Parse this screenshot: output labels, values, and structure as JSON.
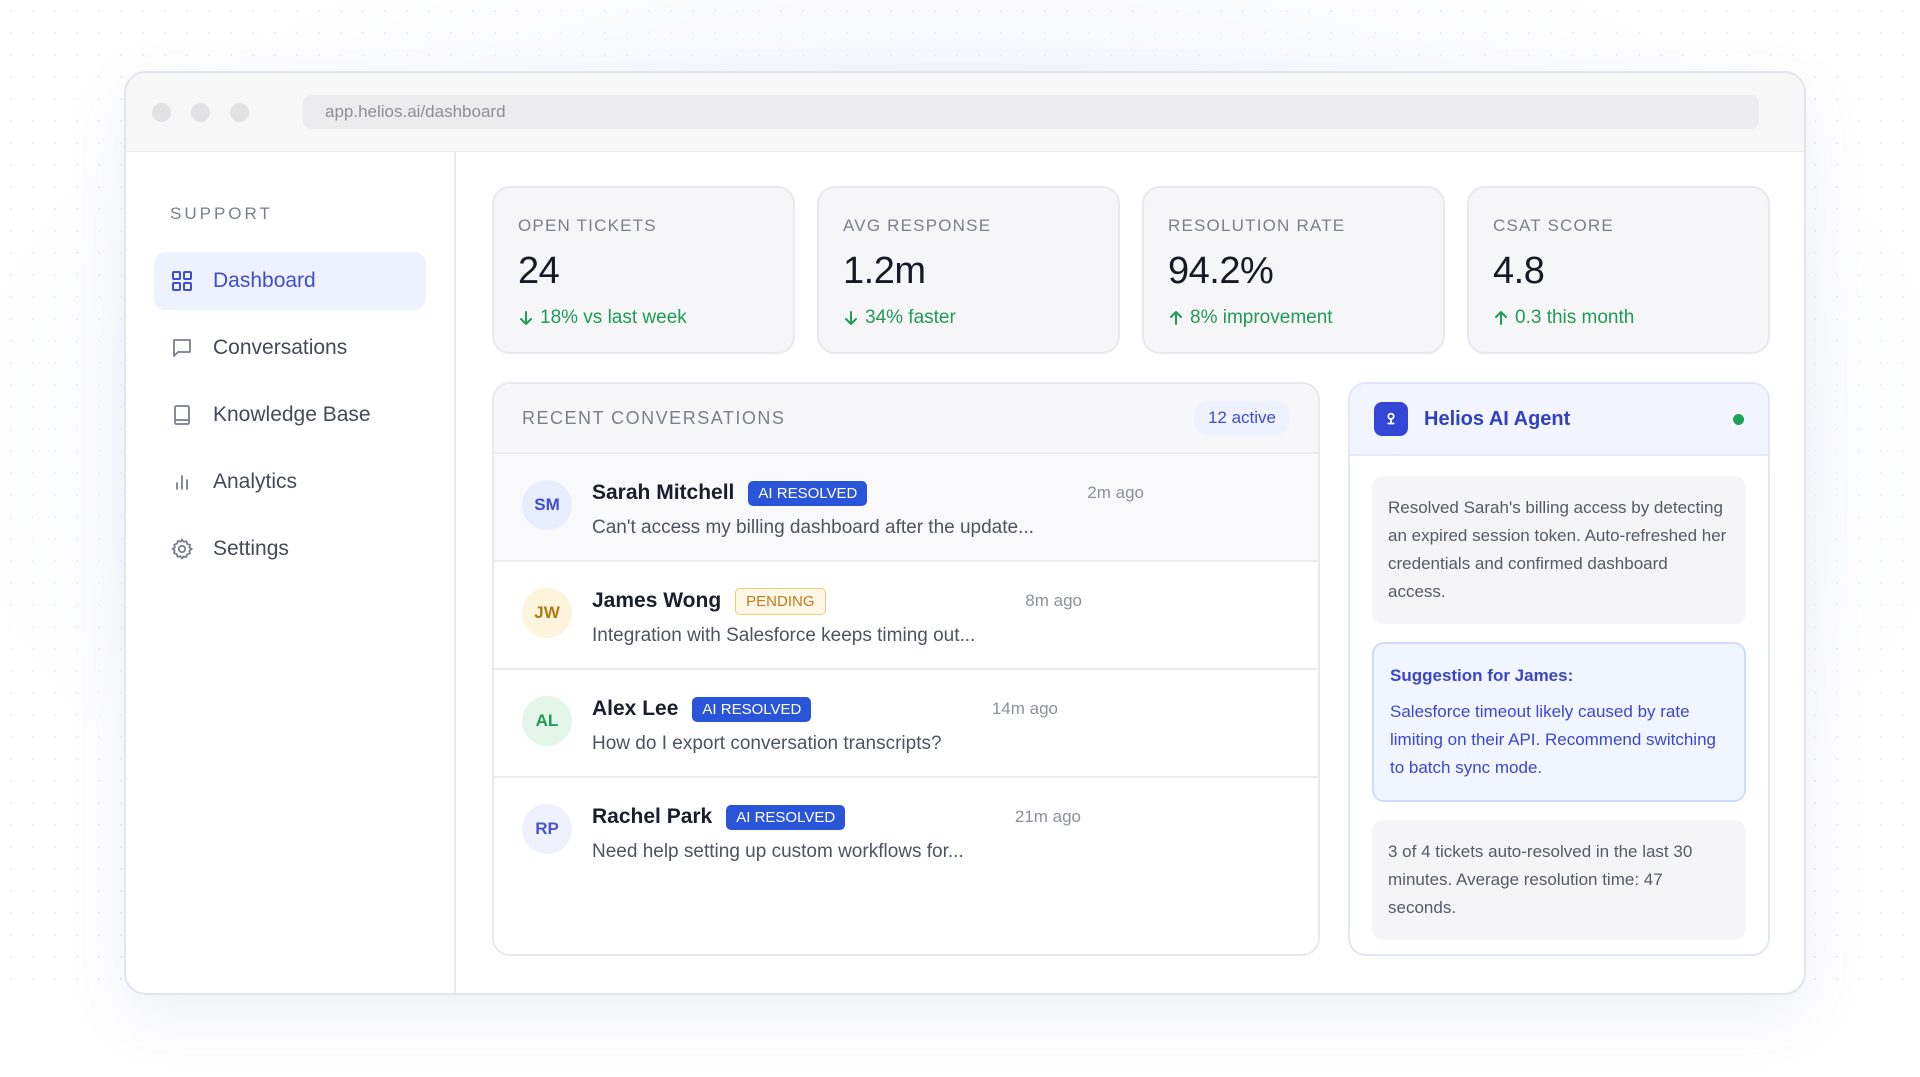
{
  "browser": {
    "url": "app.helios.ai/dashboard"
  },
  "sidebar": {
    "title": "SUPPORT",
    "items": [
      {
        "label": "Dashboard",
        "icon": "grid-icon",
        "active": true
      },
      {
        "label": "Conversations",
        "icon": "chat-icon",
        "active": false
      },
      {
        "label": "Knowledge Base",
        "icon": "book-icon",
        "active": false
      },
      {
        "label": "Analytics",
        "icon": "bar-chart-icon",
        "active": false
      },
      {
        "label": "Settings",
        "icon": "gear-icon",
        "active": false
      }
    ]
  },
  "stats": [
    {
      "label": "OPEN TICKETS",
      "value": "24",
      "trend": "18% vs last week",
      "direction": "down"
    },
    {
      "label": "AVG RESPONSE",
      "value": "1.2m",
      "trend": "34% faster",
      "direction": "down"
    },
    {
      "label": "RESOLUTION RATE",
      "value": "94.2%",
      "trend": "8% improvement",
      "direction": "up"
    },
    {
      "label": "CSAT SCORE",
      "value": "4.8",
      "trend": "0.3 this month",
      "direction": "up"
    }
  ],
  "conversations": {
    "title": "RECENT CONVERSATIONS",
    "active_count": "12 active",
    "rows": [
      {
        "initials": "SM",
        "name": "Sarah Mitchell",
        "badge": "AI RESOLVED",
        "time": "2m ago",
        "preview": "Can't access my billing dashboard after the update..."
      },
      {
        "initials": "JW",
        "name": "James Wong",
        "badge": "PENDING",
        "time": "8m ago",
        "preview": "Integration with Salesforce keeps timing out..."
      },
      {
        "initials": "AL",
        "name": "Alex Lee",
        "badge": "AI RESOLVED",
        "time": "14m ago",
        "preview": "How do I export conversation transcripts?"
      },
      {
        "initials": "RP",
        "name": "Rachel Park",
        "badge": "AI RESOLVED",
        "time": "21m ago",
        "preview": "Need help setting up custom workflows for..."
      }
    ]
  },
  "agent": {
    "name": "Helios AI Agent",
    "status_color": "#1fa35a",
    "messages": {
      "resolved": "Resolved Sarah's billing access by detecting an expired session token. Auto-refreshed her credentials and confirmed dashboard access.",
      "suggestion_title": "Suggestion for James:",
      "suggestion_body": "Salesforce timeout likely caused by rate limiting on their API. Recommend switching to batch sync mode.",
      "summary": "3 of 4 tickets auto-resolved in the last 30 minutes. Average resolution time: 47 seconds."
    }
  },
  "colors": {
    "accent": "#3f4cd4",
    "positive": "#1f9b55",
    "badge_ai": "#2b55d9",
    "badge_pending": "#c27a1a"
  }
}
